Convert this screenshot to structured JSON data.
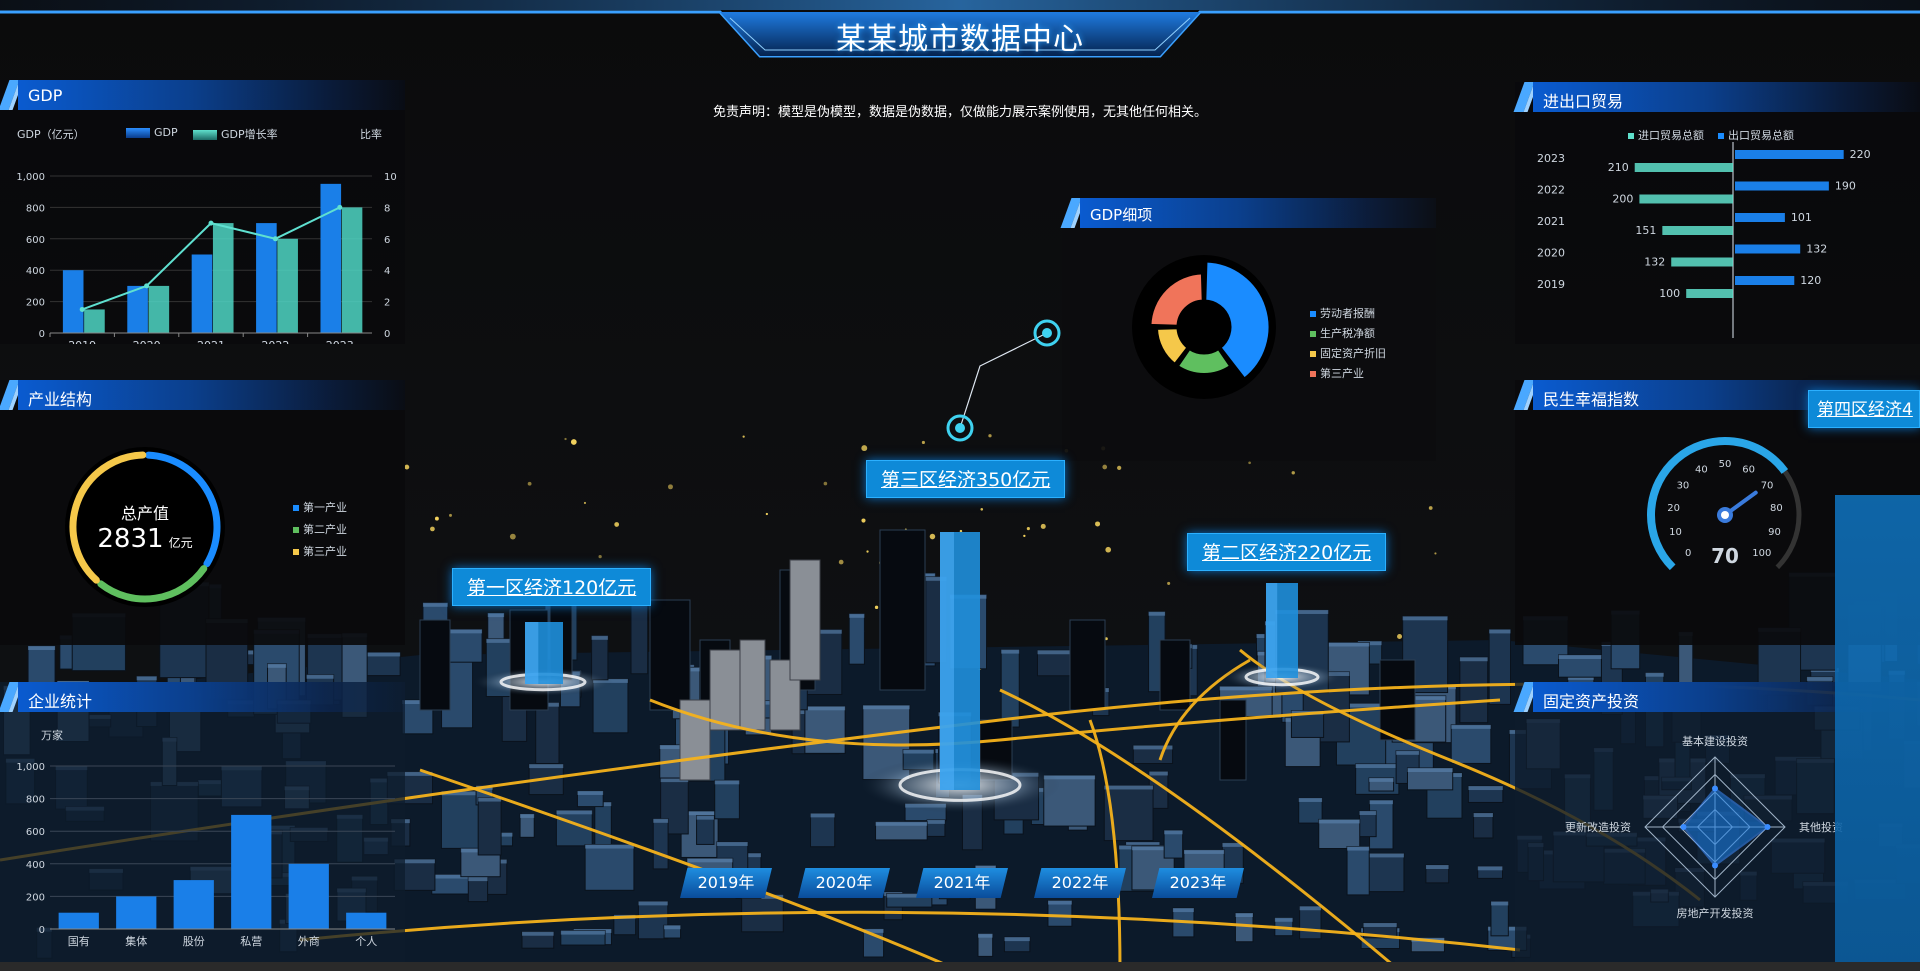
{
  "title": "某某城市数据中心",
  "disclaimer": "免责声明：模型是伪模型，数据是伪数据，仅做能力展示案例使用，无其他任何相关。",
  "colors": {
    "accent": "#1a8cff",
    "teal": "#4fd6c4",
    "yellow": "#f5c84a",
    "green": "#5fbf5f",
    "red": "#f0745a",
    "building": "#1e3a56",
    "road": "#f5b21b"
  },
  "panels": {
    "gdp": {
      "title": "GDP",
      "ylabel_left": "GDP（亿元）",
      "ylabel_right": "比率",
      "legend": [
        "GDP",
        "GDP增长率"
      ],
      "y_ticks_left": [
        "1,000",
        "800",
        "600",
        "400",
        "200",
        "0"
      ],
      "y_ticks_right": [
        "10",
        "8",
        "6",
        "4",
        "2",
        "0"
      ],
      "categories": [
        "2019",
        "2020",
        "2021",
        "2022",
        "2023"
      ]
    },
    "industry": {
      "title": "产业结构",
      "center_label": "总产值",
      "center_value": "2831",
      "center_unit": "亿元",
      "legend": [
        "第一产业",
        "第二产业",
        "第三产业"
      ]
    },
    "enterprise": {
      "title": "企业统计",
      "unit": "万家",
      "y_ticks": [
        "1,000",
        "800",
        "600",
        "400",
        "200",
        "0"
      ],
      "categories": [
        "国有",
        "集体",
        "股份",
        "私营",
        "外商",
        "个人"
      ]
    },
    "gdp_detail": {
      "title": "GDP细项",
      "legend": [
        "劳动者报酬",
        "生产税净额",
        "固定资产折旧",
        "第三产业"
      ]
    },
    "trade": {
      "title": "进出口贸易",
      "legend": [
        "进口贸易总额",
        "出口贸易总额"
      ],
      "years": [
        "2023",
        "2022",
        "2021",
        "2020",
        "2019"
      ]
    },
    "happiness": {
      "title": "民生幸福指数",
      "ticks": [
        "0",
        "10",
        "20",
        "30",
        "40",
        "50",
        "60",
        "70",
        "80",
        "90",
        "100"
      ],
      "value_label": "70"
    },
    "investment": {
      "title": "固定资产投资",
      "axes": [
        "基本建设投资",
        "其他投资",
        "房地产开发投资",
        "更新改造投资"
      ]
    }
  },
  "map_labels": {
    "district1": "第一区经济120亿元",
    "district2": "第二区经济220亿元",
    "district3": "第三区经济350亿元",
    "district4": "第四区经济4"
  },
  "years": [
    "2019年",
    "2020年",
    "2021年",
    "2022年",
    "2023年"
  ],
  "chart_data": [
    {
      "type": "bar",
      "title": "GDP",
      "categories": [
        "2019",
        "2020",
        "2021",
        "2022",
        "2023"
      ],
      "ylabel": "GDP（亿元）",
      "y2label": "比率",
      "ylim": [
        0,
        1000
      ],
      "y2lim": [
        0,
        10
      ],
      "series": [
        {
          "name": "GDP",
          "values": [
            400,
            300,
            500,
            700,
            950
          ]
        },
        {
          "name": "GDP增长率",
          "values": [
            150,
            300,
            700,
            600,
            800
          ]
        }
      ],
      "line": {
        "values": [
          1.5,
          3,
          7,
          6,
          8
        ]
      },
      "legend": "top"
    },
    {
      "type": "pie",
      "title": "产业结构",
      "categories": [
        "第一产业",
        "第二产业",
        "第三产业"
      ],
      "values": [
        34,
        27,
        39
      ]
    },
    {
      "type": "bar",
      "title": "企业统计",
      "categories": [
        "国有",
        "集体",
        "股份",
        "私营",
        "外商",
        "个人"
      ],
      "values": [
        100,
        200,
        300,
        700,
        400,
        100
      ],
      "ylabel": "万家",
      "ylim": [
        0,
        1000
      ]
    },
    {
      "type": "pie",
      "title": "GDP细项",
      "categories": [
        "劳动者报酬",
        "生产税净额",
        "固定资产折旧",
        "第三产业"
      ],
      "values": [
        40,
        20,
        15,
        25
      ]
    },
    {
      "type": "bar",
      "title": "进出口贸易",
      "categories": [
        "2023",
        "2022",
        "2021",
        "2020",
        "2019"
      ],
      "series": [
        {
          "name": "进口贸易总额",
          "values": [
            210,
            200,
            151,
            132,
            100
          ]
        },
        {
          "name": "出口贸易总额",
          "values": [
            220,
            190,
            101,
            132,
            120
          ]
        }
      ]
    },
    {
      "type": "bar",
      "title": "民生幸福指数",
      "values": [
        70
      ],
      "ylim": [
        0,
        100
      ]
    },
    {
      "type": "heatmap",
      "title": "固定资产投资",
      "categories": [
        "基本建设投资",
        "其他投资",
        "房地产开发投资",
        "更新改造投资"
      ],
      "values": [
        0.55,
        0.75,
        0.55,
        0.45
      ]
    }
  ]
}
